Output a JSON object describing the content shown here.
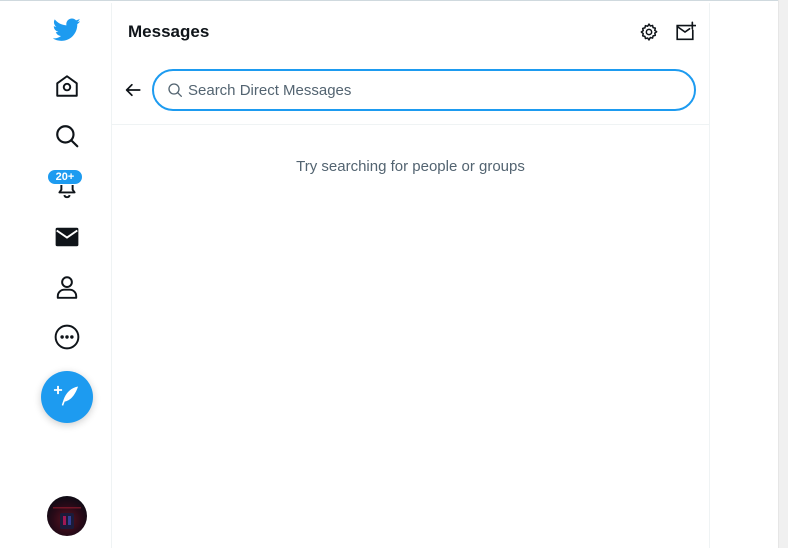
{
  "nav": {
    "items": [
      {
        "name": "twitter-logo",
        "icon": "twitter-bird-icon"
      },
      {
        "name": "home",
        "icon": "home-icon"
      },
      {
        "name": "explore",
        "icon": "search-icon"
      },
      {
        "name": "notifications",
        "icon": "bell-icon",
        "badge": "20+"
      },
      {
        "name": "messages",
        "icon": "envelope-icon"
      },
      {
        "name": "profile",
        "icon": "person-icon"
      },
      {
        "name": "more",
        "icon": "more-circle-icon"
      }
    ],
    "notifications_badge": "20+",
    "compose_icon": "feather-plus-icon"
  },
  "messages": {
    "title": "Messages",
    "settings_icon": "gear-icon",
    "new_message_icon": "new-message-icon",
    "back_icon": "arrow-left-icon",
    "search": {
      "placeholder": "Search Direct Messages",
      "value": ""
    },
    "empty_hint": "Try searching for people or groups"
  },
  "colors": {
    "accent": "#1d9bf0",
    "text": "#0f1419",
    "secondary_text": "#536471",
    "divider": "#eff3f4"
  }
}
